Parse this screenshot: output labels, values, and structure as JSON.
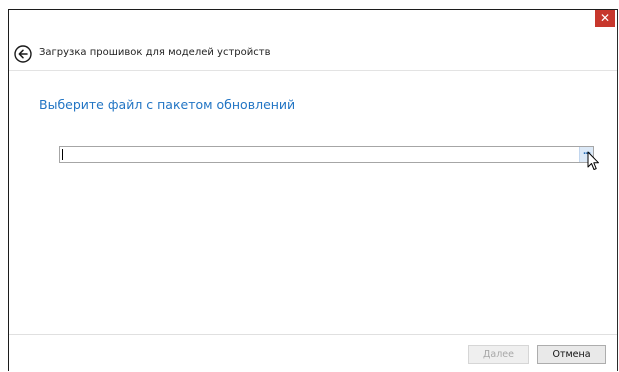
{
  "window": {
    "close_glyph": "✕"
  },
  "header": {
    "back_icon": "arrow-left-circle-icon",
    "title": "Загрузка прошивок для моделей устройств"
  },
  "main": {
    "heading": "Выберите файл с пакетом обновлений",
    "file_input": {
      "value": "",
      "placeholder": ""
    },
    "browse_label": "..."
  },
  "footer": {
    "next_label": "Далее",
    "next_enabled": false,
    "cancel_label": "Отмена"
  },
  "colors": {
    "accent": "#2275c4",
    "close": "#c7372c"
  }
}
